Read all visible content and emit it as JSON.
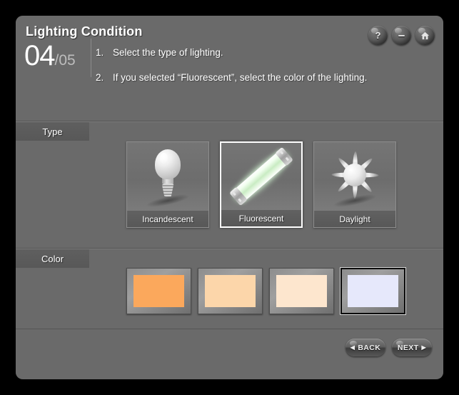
{
  "window": {
    "title": "Lighting Condition",
    "step_current": "04",
    "step_total": "/05"
  },
  "controls": [
    {
      "name": "help-button",
      "icon": "question-mark-icon",
      "glyph": "?"
    },
    {
      "name": "minimize-button",
      "icon": "minus-icon",
      "glyph": "-"
    },
    {
      "name": "home-button",
      "icon": "home-icon",
      "glyph": ""
    }
  ],
  "instructions": [
    {
      "num": "1.",
      "text": "Select the type of lighting."
    },
    {
      "num": "2.",
      "text": "If you selected “Fluorescent”, select the color of the lighting."
    }
  ],
  "type_section": {
    "label": "Type",
    "tiles": [
      {
        "label": "Incandescent",
        "icon": "light-bulb-icon",
        "selected": false
      },
      {
        "label": "Fluorescent",
        "icon": "fluorescent-tube-icon",
        "selected": true
      },
      {
        "label": "Daylight",
        "icon": "sun-icon",
        "selected": false
      }
    ]
  },
  "color_section": {
    "label": "Color",
    "swatches": [
      {
        "name": "color-swatch-warm-orange",
        "color": "#FBA85C",
        "selected": false
      },
      {
        "name": "color-swatch-light-peach",
        "color": "#FCD6AA",
        "selected": false
      },
      {
        "name": "color-swatch-pale-peach",
        "color": "#FDE6CE",
        "selected": false
      },
      {
        "name": "color-swatch-cool-white",
        "color": "#E6E8FB",
        "selected": true
      }
    ]
  },
  "footer": {
    "back_label": "BACK",
    "back_arrow": "◀",
    "next_label": "NEXT",
    "next_arrow": "▶"
  },
  "theme": {
    "panel_bg": "#6a6a6a",
    "outer_bg": "#000000",
    "text": "#ffffff",
    "accent_selected": "#ffffff"
  }
}
